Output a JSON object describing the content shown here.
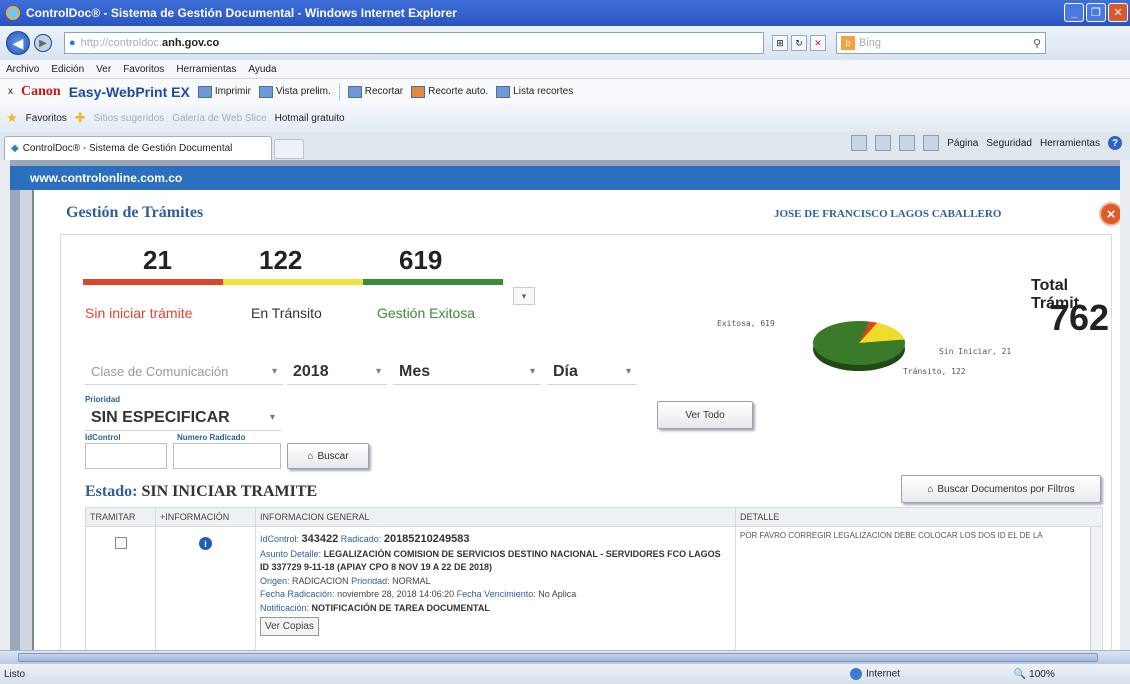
{
  "window": {
    "title": "ControlDoc® - Sistema de Gestión Documental - Windows Internet Explorer"
  },
  "address": {
    "url_faded": "http://controldoc.",
    "url_bold": "anh.gov.co",
    "search_placeholder": "Bing"
  },
  "menu": [
    "Archivo",
    "Edición",
    "Ver",
    "Favoritos",
    "Herramientas",
    "Ayuda"
  ],
  "canonbar": {
    "close": "x",
    "brand": "Canon",
    "product": "Easy-WebPrint EX",
    "print": "Imprimir",
    "preview": "Vista prelim.",
    "clip": "Recortar",
    "autoclip": "Recorte auto.",
    "cliplist": "Lista recortes"
  },
  "favbar": {
    "favorites": "Favoritos",
    "suggested": "Sitios sugeridos",
    "gallery": "Galería de Web Slice",
    "hotmail": "Hotmail gratuito"
  },
  "tab": {
    "label": "ControlDoc® - Sistema de Gestión Documental"
  },
  "commandbar": {
    "page": "Página",
    "security": "Seguridad",
    "tools": "Herramientas"
  },
  "site": {
    "header": "www.controlonline.com.co"
  },
  "modal": {
    "title": "Gestión de Trámites",
    "user": "JOSE DE FRANCISCO LAGOS CABALLERO",
    "close": "×"
  },
  "stats": {
    "sin_iniciar": {
      "value": "21",
      "label": "Sin iniciar trámite",
      "color": "#d9472b"
    },
    "transito": {
      "value": "122",
      "label": "En Tránsito",
      "color": "#f0e23a"
    },
    "exitosa": {
      "value": "619",
      "label": "Gestión Exitosa",
      "color": "#3d8a37"
    },
    "total_label": "Total Trámit",
    "total_value": "762"
  },
  "chart_data": {
    "type": "pie",
    "categories": [
      "Exitosa",
      "Sin Iniciar",
      "Tránsito"
    ],
    "values": [
      619,
      21,
      122
    ],
    "labels": [
      "Exitosa, 619",
      "Sin Iniciar, 21",
      "Tránsito, 122"
    ],
    "colors": [
      "#3a7a2a",
      "#e0451f",
      "#f0dc2a"
    ]
  },
  "filters": {
    "clase": "Clase de Comunicación",
    "year": "2018",
    "mes": "Mes",
    "dia": "Día",
    "prioridad_label": "Prioridad",
    "prioridad": "SIN ESPECIFICAR",
    "idcontrol_label": "IdControl",
    "radicado_label": "Numero Radicado",
    "buscar": "Buscar",
    "ver_todo": "Ver Todo",
    "buscar_filtros": "Buscar Documentos por Filtros"
  },
  "estado": {
    "label": "Estado:",
    "value": "SIN INICIAR TRAMITE"
  },
  "table": {
    "headers": [
      "TRAMITAR",
      "+INFORMACIÓN",
      "INFORMACION GENERAL",
      "DETALLE"
    ],
    "row": {
      "idcontrol_k": "IdControl:",
      "idcontrol": "343422",
      "radicado_k": "Radicado:",
      "radicado": "20185210249583",
      "asunto_k": "Asunto Detalle:",
      "asunto": "LEGALIZACIÓN COMISION DE SERVICIOS DESTINO NACIONAL - SERVIDORES FCO LAGOS ID 337729 9-11-18 (APIAY CPO 8 NOV 19 A 22 DE 2018)",
      "origen_k": "Origen:",
      "origen": "RADICACION",
      "prioridad_k": "Prioridad:",
      "prioridad": "NORMAL",
      "fecha_k": "Fecha Radicación:",
      "fecha": "noviembre 28, 2018 14:06:20",
      "venc_k": "Fecha Vencimiento:",
      "venc": "No Aplica",
      "notif_k": "Notificación:",
      "notif": "NOTIFICACIÓN DE TAREA DOCUMENTAL",
      "ver_copias": "Ver Copias",
      "detalle": "POR FAVRO CORREGIR LEGALIZACION DEBE COLOCAR LOS DOS ID EL DE LA"
    }
  },
  "status": {
    "left": "Listo",
    "zone": "Internet",
    "zoom": "100%"
  }
}
